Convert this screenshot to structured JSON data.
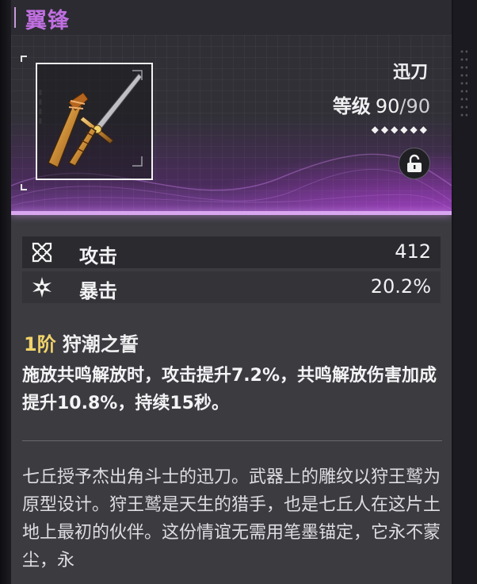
{
  "weapon": {
    "name": "翼锋",
    "type": "迅刀",
    "level_label": "等级",
    "level_current": "90",
    "level_separator": "/",
    "level_max": "90",
    "rank_diamonds": "◆◆◆◆◆◆",
    "rarity_color": "#d9a6f0",
    "name_color": "#c06fe0",
    "lock_state": "unlocked"
  },
  "stats": [
    {
      "icon": "crossed-swords-icon",
      "label": "攻击",
      "value": "412"
    },
    {
      "icon": "crit-star-icon",
      "label": "暴击",
      "value": "20.2%"
    }
  ],
  "passive": {
    "rank": "1阶",
    "name": "狩潮之誓",
    "description": "施放共鸣解放时，攻击提升7.2%，共鸣解放伤害加成提升10.8%，持续15秒。",
    "rank_color": "#f1d36a"
  },
  "lore": "七丘授予杰出角斗士的迅刀。武器上的雕纹以狩王鹫为原型设计。狩王鹫是天生的猎手，也是七丘人在这片土地上最初的伙伴。这份情谊无需用笔墨锚定，它永不蒙尘，永"
}
